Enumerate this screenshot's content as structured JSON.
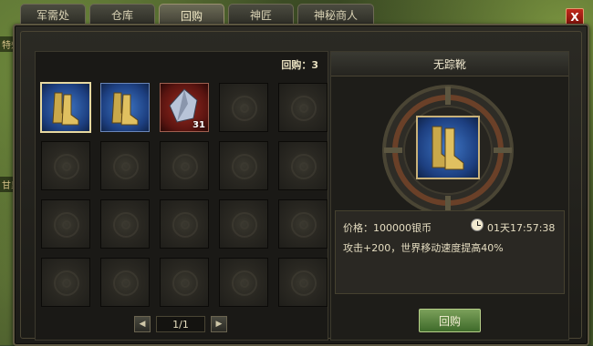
{
  "background": {
    "label_1": "特效",
    "label_2": "甘泉"
  },
  "tabs": [
    {
      "label": "军需处",
      "active": false
    },
    {
      "label": "仓库",
      "active": false
    },
    {
      "label": "回购",
      "active": true
    },
    {
      "label": "神匠",
      "active": false
    },
    {
      "label": "神秘商人",
      "active": false
    }
  ],
  "close_label": "X",
  "left": {
    "buyback_label": "回购：3",
    "slots": [
      {
        "item": "boots-icon",
        "qty": ""
      },
      {
        "item": "boots-icon",
        "qty": ""
      },
      {
        "item": "crystal-ore-icon",
        "qty": "31"
      }
    ],
    "pager": {
      "prev": "◀",
      "page": "1/1",
      "next": "▶"
    }
  },
  "detail": {
    "name": "无踪靴",
    "price": "价格：100000银币",
    "timer": "01天17:57:38",
    "attribute": "攻击+200，世界移动速度提高40%",
    "buy_label": "回购"
  },
  "colors": {
    "accent": "#c9b27a",
    "panel": "#1e1d19",
    "buy_button": "#5a8a3a"
  }
}
